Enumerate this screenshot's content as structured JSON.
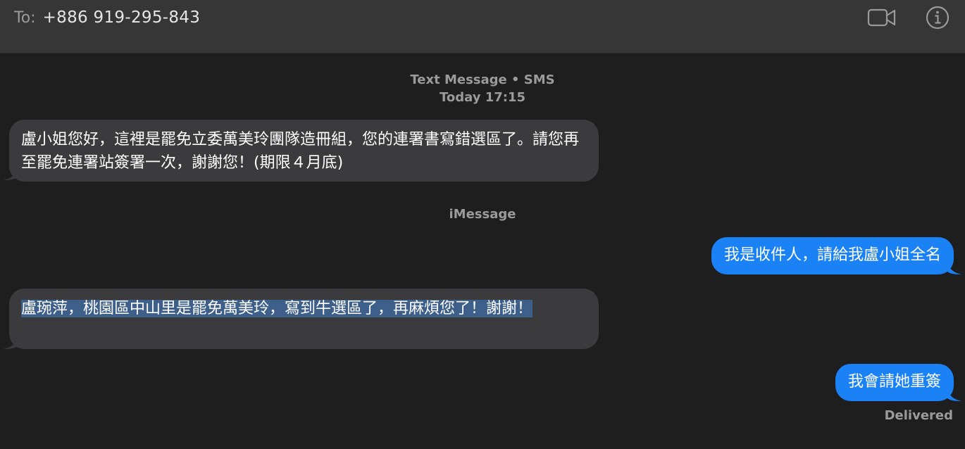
{
  "header": {
    "to_label": "To:",
    "recipient": "+886 919-295-843",
    "video_icon": "video-camera-icon",
    "info_icon": "info-icon"
  },
  "transcript": {
    "service_label": "Text Message • SMS",
    "timestamp": "Today 17:15",
    "imessage_label": "iMessage",
    "messages": [
      {
        "direction": "incoming",
        "text": "盧小姐您好，這裡是罷免立委萬美玲團隊造冊組，您的連署書寫錯選區了。請您再至罷免連署站簽署一次，謝謝您！(期限４月底)"
      },
      {
        "direction": "outgoing",
        "text": "我是收件人，請給我盧小姐全名"
      },
      {
        "direction": "incoming",
        "text": "盧琬萍，桃園區中山里是罷免萬美玲，寫到牛選區了，再麻煩您了！謝謝！",
        "selected": true
      },
      {
        "direction": "outgoing",
        "text": "我會請她重簽"
      }
    ],
    "status": "Delivered"
  },
  "colors": {
    "header_bg": "#363636",
    "background": "#1e1e1e",
    "incoming_bubble": "#3b3b3d",
    "outgoing_bubble": "#1b82f5",
    "selection_highlight": "#3d5f8a",
    "meta_text": "#9b9b9b"
  }
}
